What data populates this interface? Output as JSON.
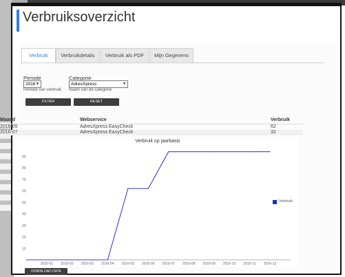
{
  "header": {
    "title": "Verbruiksoverzicht"
  },
  "tabs": [
    {
      "label": "Verbruik",
      "active": true
    },
    {
      "label": "Verbruikdetails",
      "active": false
    },
    {
      "label": "Verbruik als PDF",
      "active": false
    },
    {
      "label": "Mijn Gegevens",
      "active": false
    }
  ],
  "filters": {
    "periode": {
      "label": "Periode",
      "value": "2016",
      "hint": "Periode van verbruik"
    },
    "categorie": {
      "label": "Categorie",
      "value": "AdresXpress",
      "hint": "Naam van de categorie"
    },
    "filter_label": "FILTER",
    "reset_label": "RESET"
  },
  "table": {
    "headers": [
      "Maand",
      "Webservice",
      "Verbruik"
    ],
    "rows": [
      [
        "2016-05",
        "AdresXpress EasyCheck",
        "62"
      ],
      [
        "2016-07",
        "AdresXpress EasyCheck",
        "32"
      ]
    ]
  },
  "chart_data": {
    "type": "line",
    "title": "Verbruik op jaarbasis",
    "categories": [
      "2016-01",
      "2016-02",
      "2016-03",
      "2016-04",
      "2016-05",
      "2016-06",
      "2016-07",
      "2016-08",
      "2016-09",
      "2016-10",
      "2016-11",
      "2016-12"
    ],
    "series": [
      {
        "name": "Verbruik",
        "values": [
          0,
          0,
          0,
          0,
          62,
          62,
          94,
          94,
          94,
          94,
          94,
          94
        ],
        "color": "#3a3ae0"
      }
    ],
    "yticks": [
      10,
      20,
      30,
      40,
      50,
      60,
      70,
      80,
      90
    ],
    "ylim": [
      0,
      98
    ],
    "grid": false,
    "legend": "right"
  },
  "download_label": "DOWNLOAD DATA"
}
